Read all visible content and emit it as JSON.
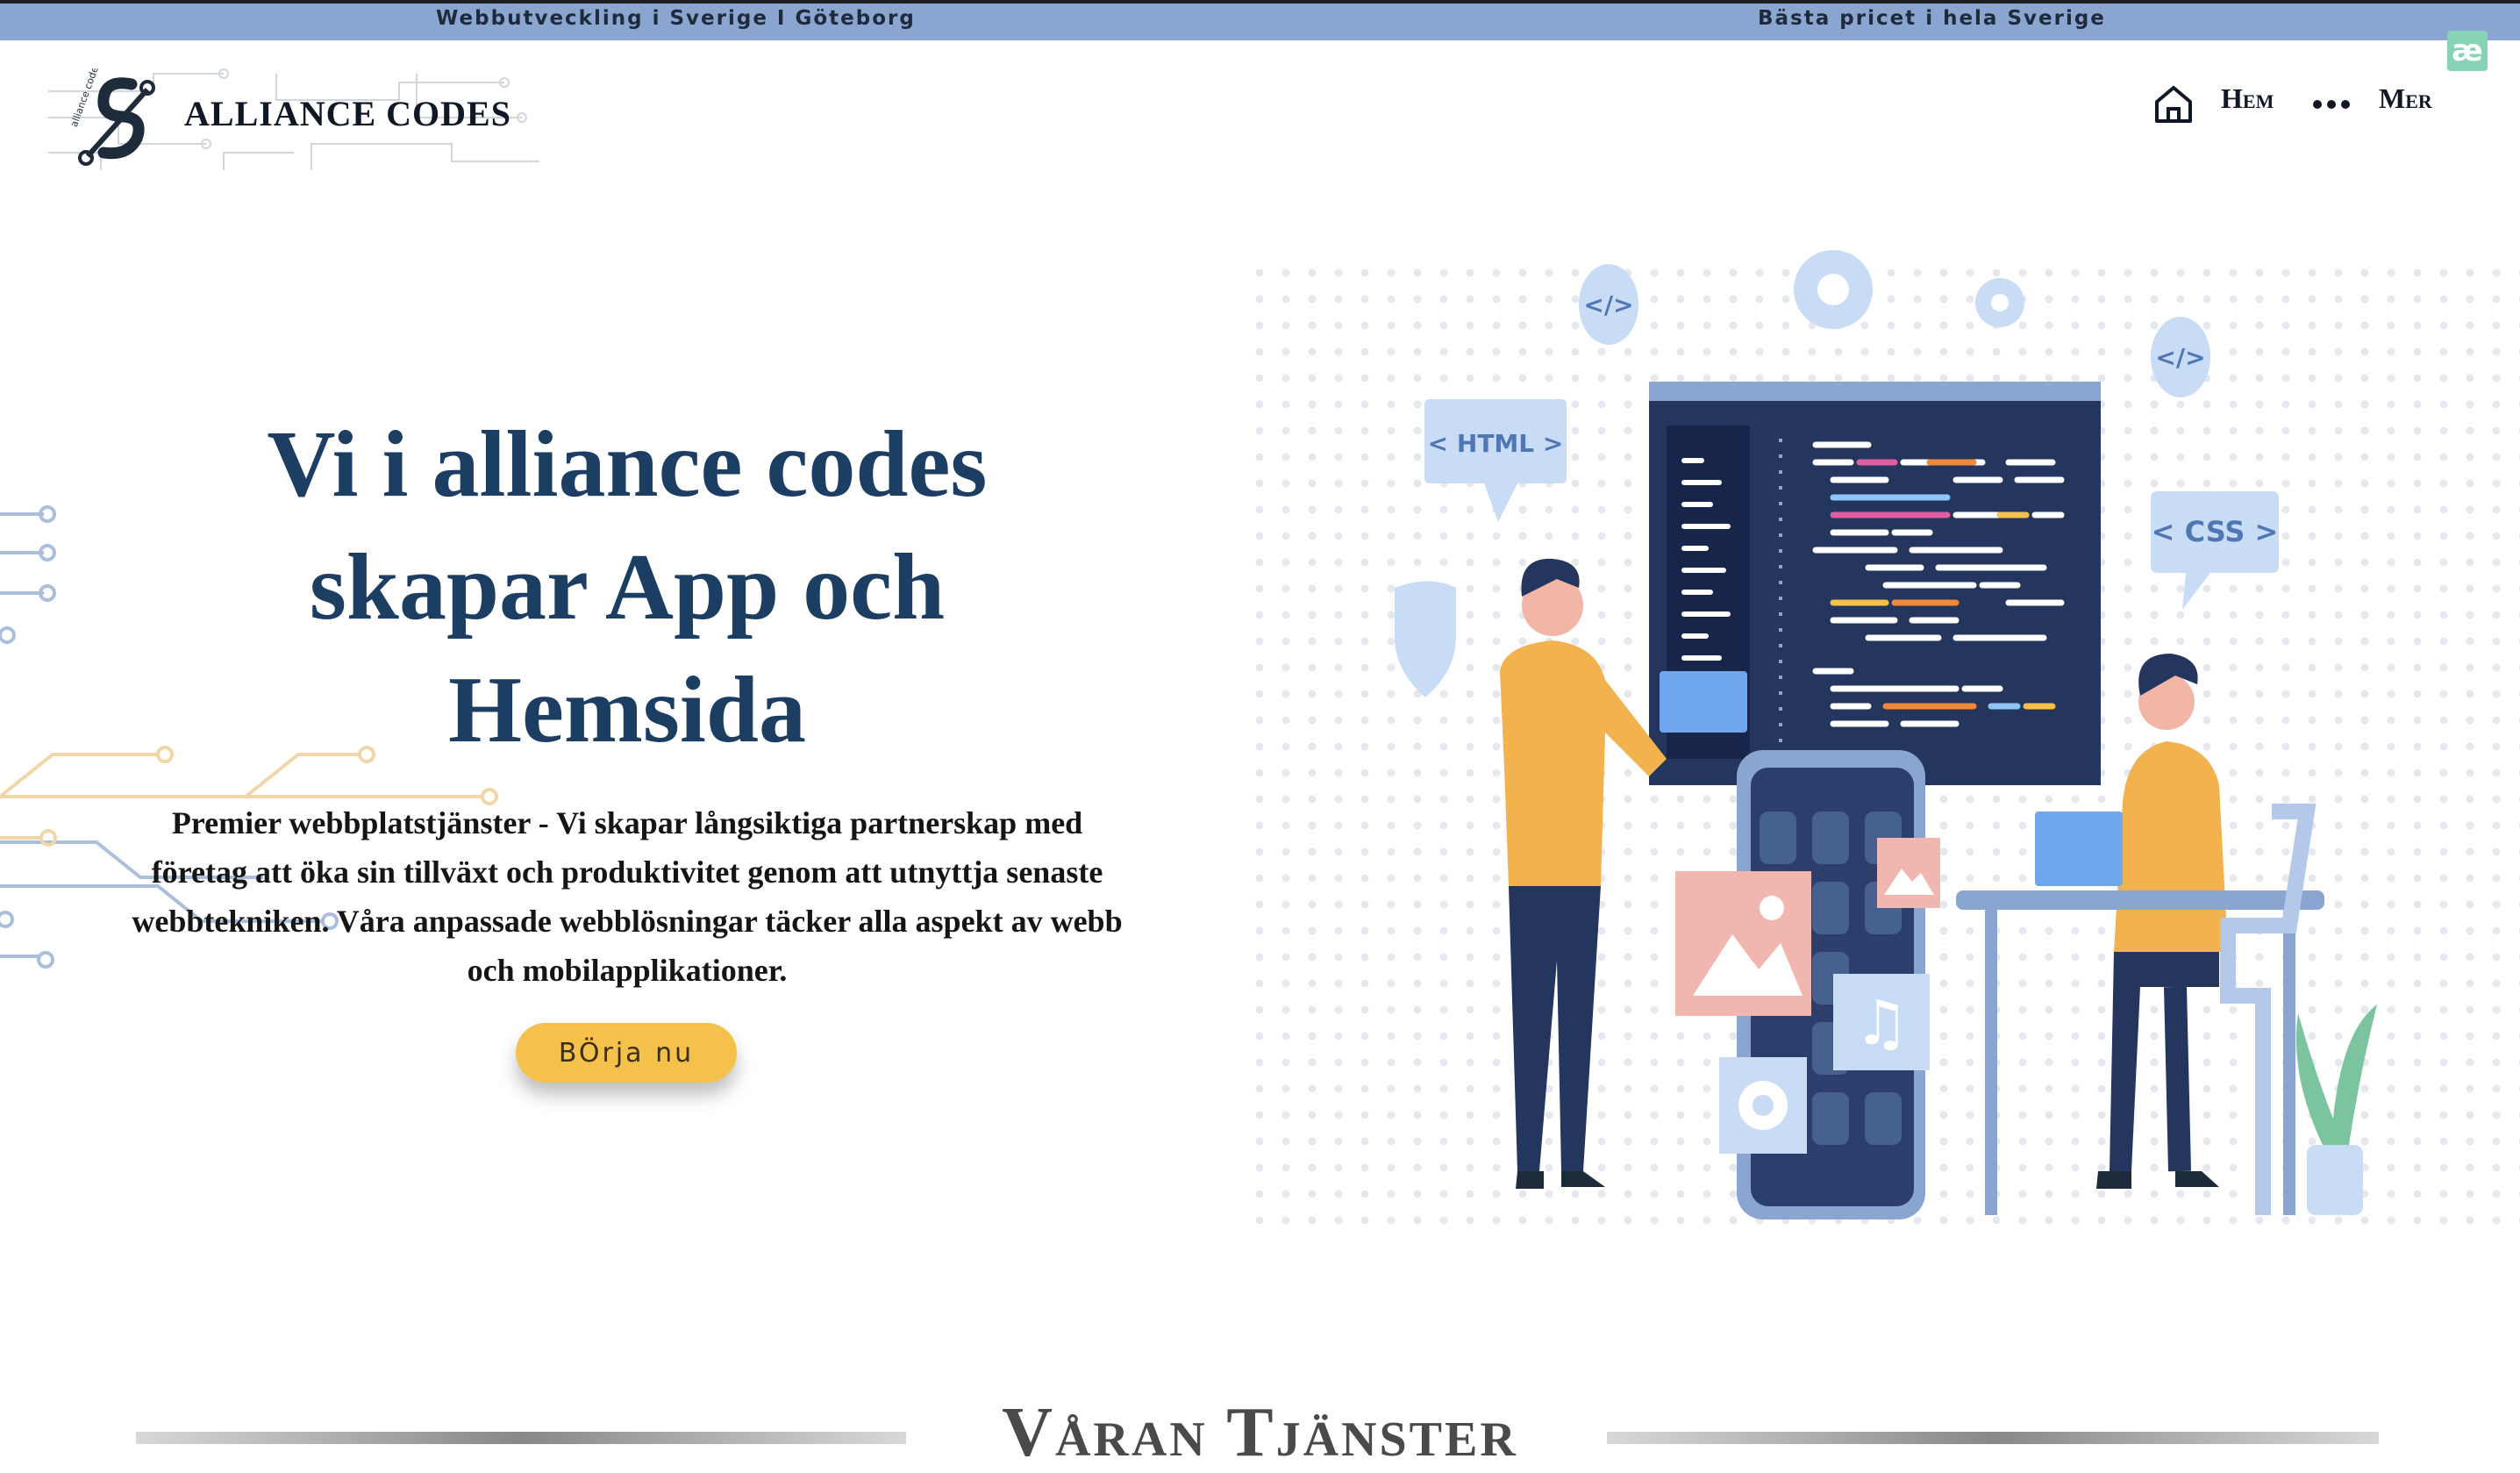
{
  "topbar": {
    "left_text": "Webbutveckling i Sverige I Göteborg",
    "right_text": "Bästa pricet i hela Sverige"
  },
  "brand": {
    "name": "ALLIANCE CODES",
    "badge": "æ",
    "logo_ring_text": "alliance codes"
  },
  "nav": {
    "home_label": "Hem",
    "more_label": "Mer"
  },
  "hero": {
    "title": "Vi i alliance codes skapar App och Hemsida",
    "subtitle": "Premier webbplatstjänster - Vi skapar långsiktiga partnerskap med företag att öka sin tillväxt och produktivitet genom att utnyttja senaste webbtekniken. Våra anpassade webblösningar täcker alla aspekt av webb och mobilapplikationer.",
    "cta_label": "BÖrja nu",
    "illustration": {
      "bubble_html": "< HTML >",
      "bubble_css": "< CSS >",
      "code_icon": "</>"
    }
  },
  "services": {
    "title": "Våran Tjänster"
  },
  "colors": {
    "topbar": "#8aa5cf",
    "heading": "#1d3e63",
    "cta": "#f5c14a",
    "badge": "#86d3b5"
  }
}
